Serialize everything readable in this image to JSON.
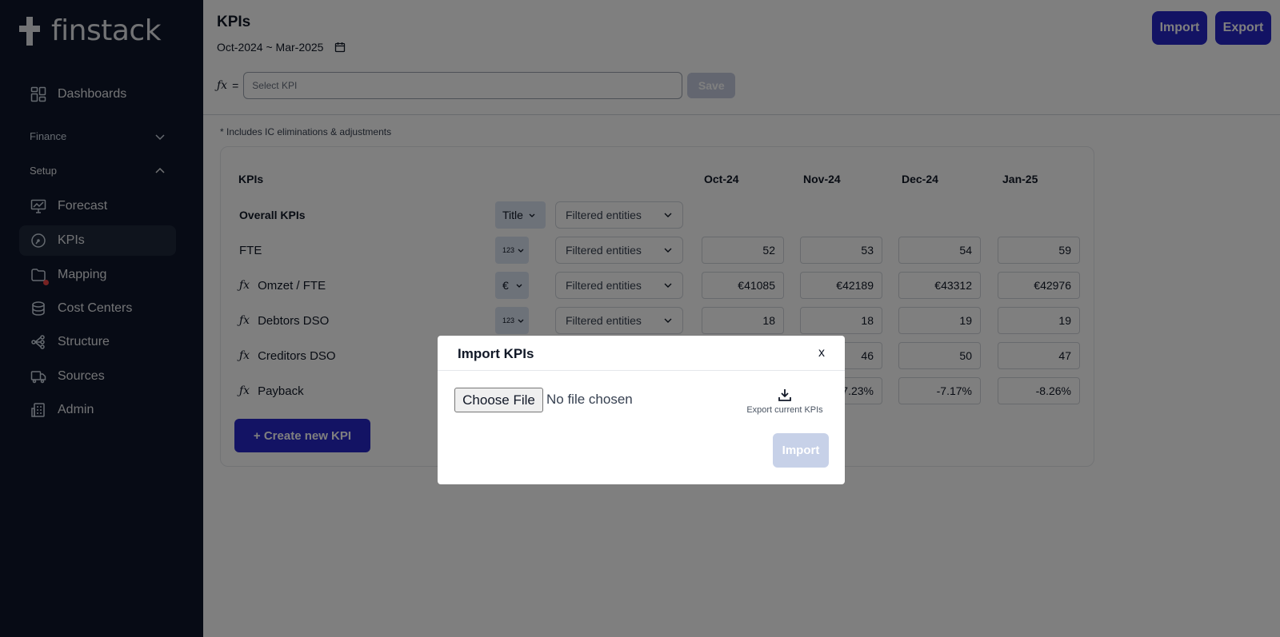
{
  "app": {
    "brand": "finstack"
  },
  "sidebar": {
    "items": [
      {
        "label": "Dashboards",
        "icon": "grid-icon"
      },
      {
        "label": "Forecast",
        "icon": "presentation-chart-icon"
      },
      {
        "label": "KPIs",
        "icon": "gauge-icon"
      },
      {
        "label": "Mapping",
        "icon": "folder-icon"
      },
      {
        "label": "Cost Centers",
        "icon": "stack-icon"
      },
      {
        "label": "Structure",
        "icon": "tree-icon"
      },
      {
        "label": "Sources",
        "icon": "truck-icon"
      },
      {
        "label": "Admin",
        "icon": "building-icon"
      }
    ],
    "sections": {
      "finance": "Finance",
      "setup": "Setup"
    }
  },
  "header": {
    "title": "KPIs",
    "daterange": "Oct-2024 ~ Mar-2025",
    "import_label": "Import",
    "export_label": "Export"
  },
  "formula": {
    "fx": "fx",
    "equals": "=",
    "placeholder": "Select KPI",
    "save_label": "Save"
  },
  "note": "* Includes IC eliminations & adjustments",
  "table": {
    "label_header": "KPIs",
    "columns": [
      "Oct-24",
      "Nov-24",
      "Dec-24",
      "Jan-25"
    ],
    "entities_label": "Filtered entities",
    "rows": [
      {
        "label": "Overall KPIs",
        "type": "Title",
        "formula": false,
        "values": []
      },
      {
        "label": "FTE",
        "type": "123",
        "formula": false,
        "values": [
          "52",
          "53",
          "54",
          "59"
        ]
      },
      {
        "label": "Omzet / FTE",
        "type": "€",
        "formula": true,
        "values": [
          "€41085",
          "€42189",
          "€43312",
          "€42976"
        ]
      },
      {
        "label": "Debtors DSO",
        "type": "123",
        "formula": true,
        "values": [
          "18",
          "18",
          "19",
          "19"
        ]
      },
      {
        "label": "Creditors DSO",
        "type": "",
        "formula": true,
        "values": [
          "",
          "46",
          "50",
          "47"
        ]
      },
      {
        "label": "Payback",
        "type": "",
        "formula": true,
        "values": [
          "",
          "7.23%",
          "-7.17%",
          "-8.26%"
        ]
      }
    ],
    "create_label": "+ Create new KPI"
  },
  "modal": {
    "title": "Import KPIs",
    "close": "x",
    "choose_file": "Choose File",
    "no_file": "No file chosen",
    "export_current": "Export current KPIs",
    "import_label": "Import"
  },
  "colors": {
    "sidebar": "#0f172a",
    "accent": "#2726c9"
  }
}
